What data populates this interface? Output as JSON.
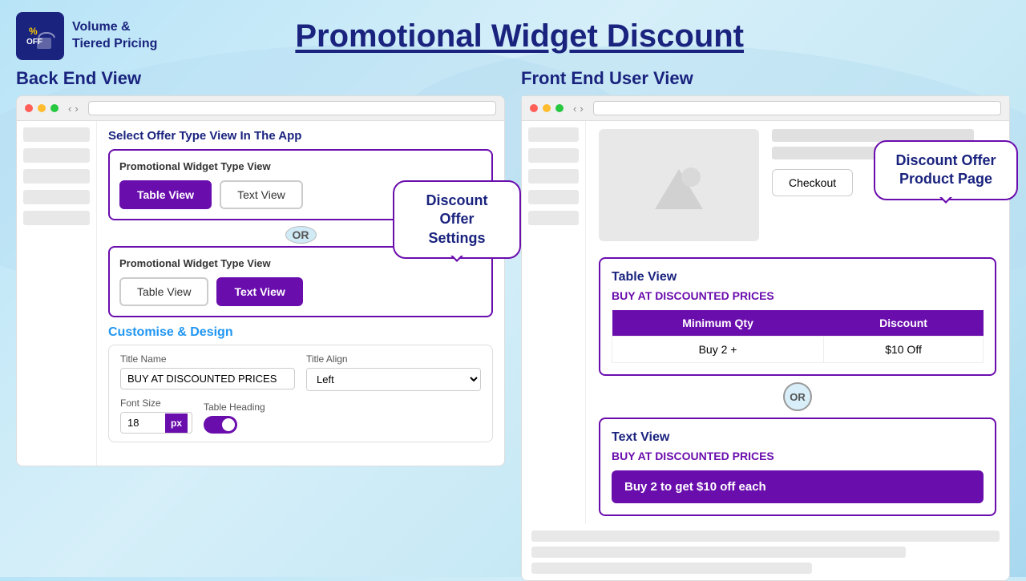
{
  "header": {
    "logo_text": "Volume &\nTiered Pricing",
    "main_title": "Promotional Widget Discount"
  },
  "left_panel": {
    "col_title": "Back End View",
    "select_offer_label": "Select Offer Type View In The App",
    "bubble": {
      "line1": "Discount Offer",
      "line2": "Settings"
    },
    "widget_card_1": {
      "label": "Promotional Widget Type View",
      "btn_table": "Table View",
      "btn_text": "Text View"
    },
    "or_text": "OR",
    "widget_card_2": {
      "label": "Promotional Widget Type View",
      "btn_table": "Table View",
      "btn_text": "Text View"
    },
    "customise_title": "Customise & Design",
    "form": {
      "title_name_label": "Title Name",
      "title_name_value": "BUY AT DISCOUNTED PRICES",
      "title_align_label": "Title Align",
      "title_align_value": "Left",
      "font_size_label": "Font Size",
      "font_size_value": "18",
      "px_label": "px",
      "table_heading_label": "Table Heading",
      "toggle_state": "on"
    }
  },
  "right_panel": {
    "col_title": "Front End User View",
    "bubble": {
      "line1": "Discount Offer",
      "line2": "Product Page"
    },
    "checkout_btn": "Checkout",
    "table_widget": {
      "title": "Table View",
      "subtitle": "BUY AT DISCOUNTED PRICES",
      "col_min_qty": "Minimum Qty",
      "col_discount": "Discount",
      "row_qty": "Buy 2 +",
      "row_discount": "$10 Off"
    },
    "or_text": "OR",
    "text_widget": {
      "title": "Text View",
      "subtitle": "BUY AT DISCOUNTED PRICES",
      "content": "Buy 2 to get $10 off each"
    }
  }
}
